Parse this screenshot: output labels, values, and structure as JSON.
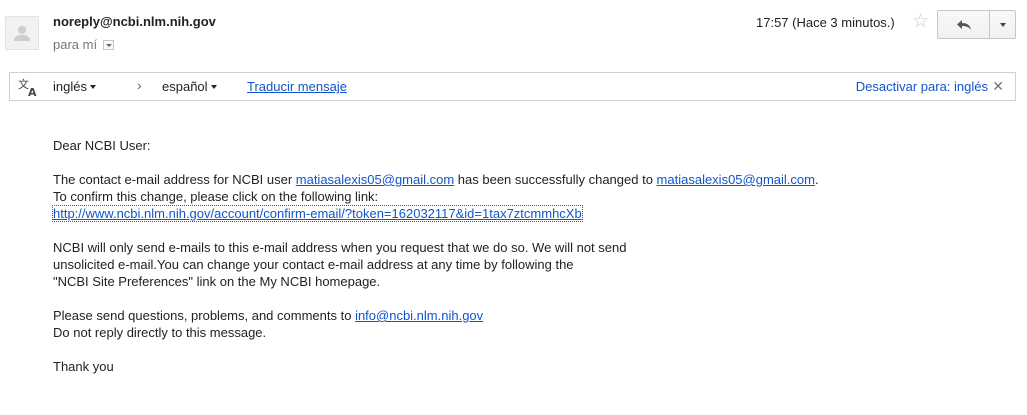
{
  "header": {
    "sender": "noreply@ncbi.nlm.nih.gov",
    "to": "para mí",
    "date": "17:57 (Hace 3 minutos.)"
  },
  "icons": {
    "avatar": "person-silhouette-icon",
    "star": "star-outline-icon",
    "reply": "reply-arrow-icon",
    "more": "dropdown-caret-icon",
    "translate": "translate-icon",
    "close": "close-icon"
  },
  "translate": {
    "source_lang": "inglés",
    "target_lang": "español",
    "translate_link": "Traducir mensaje",
    "deactivate": "Desactivar para: inglés"
  },
  "message": {
    "greeting": "Dear NCBI User:",
    "p1_a": "The contact e-mail address for NCBI user ",
    "old_email": "matiasalexis05@gmail.com",
    "p1_b": " has been successfully changed to ",
    "new_email": "matiasalexis05@gmail.com",
    "p1_c": ".",
    "p1_d": "To confirm this change, please click on the following link:",
    "confirm_url": "http://www.ncbi.nlm.nih.gov/account/confirm-email/?token=162032117&id=1tax7ztcmmhcXb",
    "p2_l1": "NCBI will only send e-mails to this e-mail address when you request that we do so. We will not send",
    "p2_l2": "unsolicited e-mail.You can change your contact e-mail address at any time by following the",
    "p2_l3": "\"NCBI Site Preferences\" link on the My NCBI homepage.",
    "p3_a": "Please send questions, problems, and comments to ",
    "info_email": "info@ncbi.nlm.nih.gov",
    "p3_b": "Do not reply directly to this message.",
    "closing": "Thank you"
  },
  "colors": {
    "link": "#1155cc",
    "text": "#222222",
    "muted": "#777777",
    "border": "#d0d0d0"
  }
}
